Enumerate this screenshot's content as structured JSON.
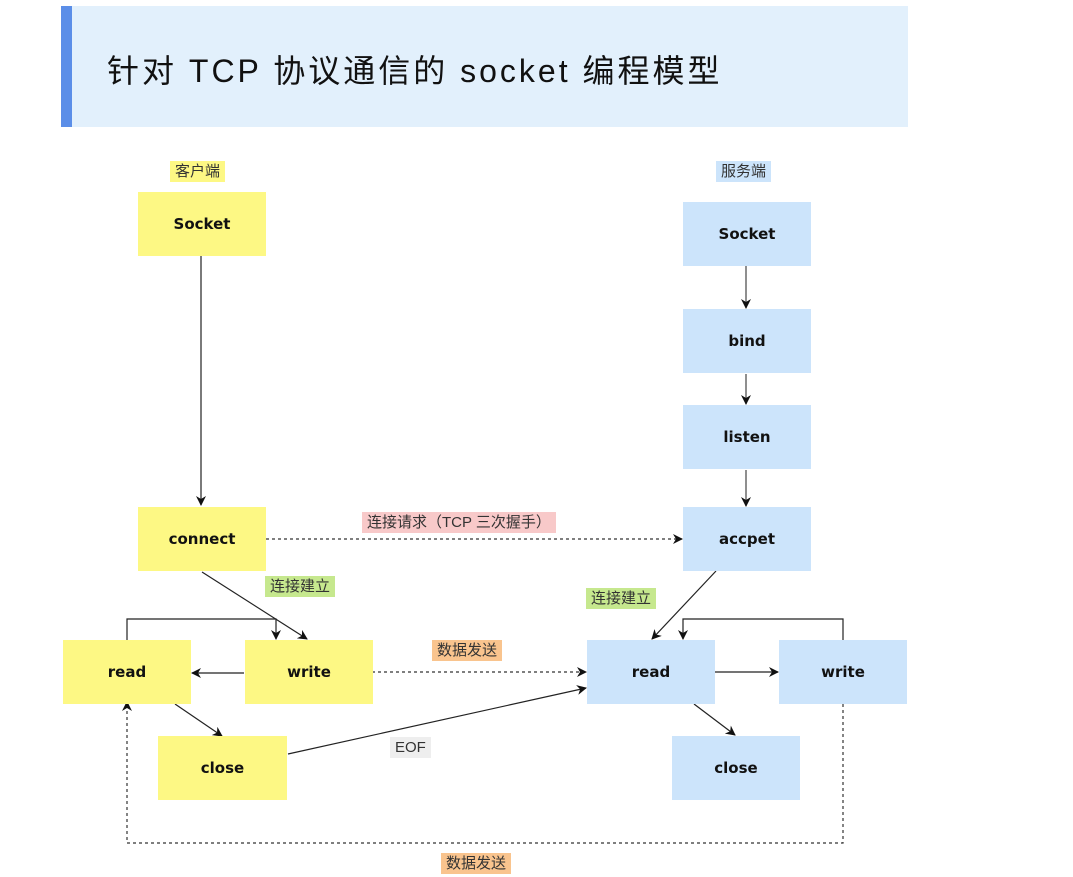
{
  "header": {
    "title": "针对 TCP 协议通信的 socket 编程模型"
  },
  "diagram": {
    "colors": {
      "client": "#fdf884",
      "server": "#cce4fb",
      "accent_bar": "#5b8ee8",
      "header_bg": "#e2f0fc"
    },
    "client": {
      "title": "客户端",
      "nodes": {
        "socket": "Socket",
        "connect": "connect",
        "read": "read",
        "write": "write",
        "close": "close"
      }
    },
    "server": {
      "title": "服务端",
      "nodes": {
        "socket": "Socket",
        "bind": "bind",
        "listen": "listen",
        "accept": "accpet",
        "read": "read",
        "write": "write",
        "close": "close"
      }
    },
    "edge_labels": {
      "connect_request": "连接请求（TCP 三次握手）",
      "client_established": "连接建立",
      "server_established": "连接建立",
      "data_send_top": "数据发送",
      "eof": "EOF",
      "data_send_bottom": "数据发送"
    }
  }
}
